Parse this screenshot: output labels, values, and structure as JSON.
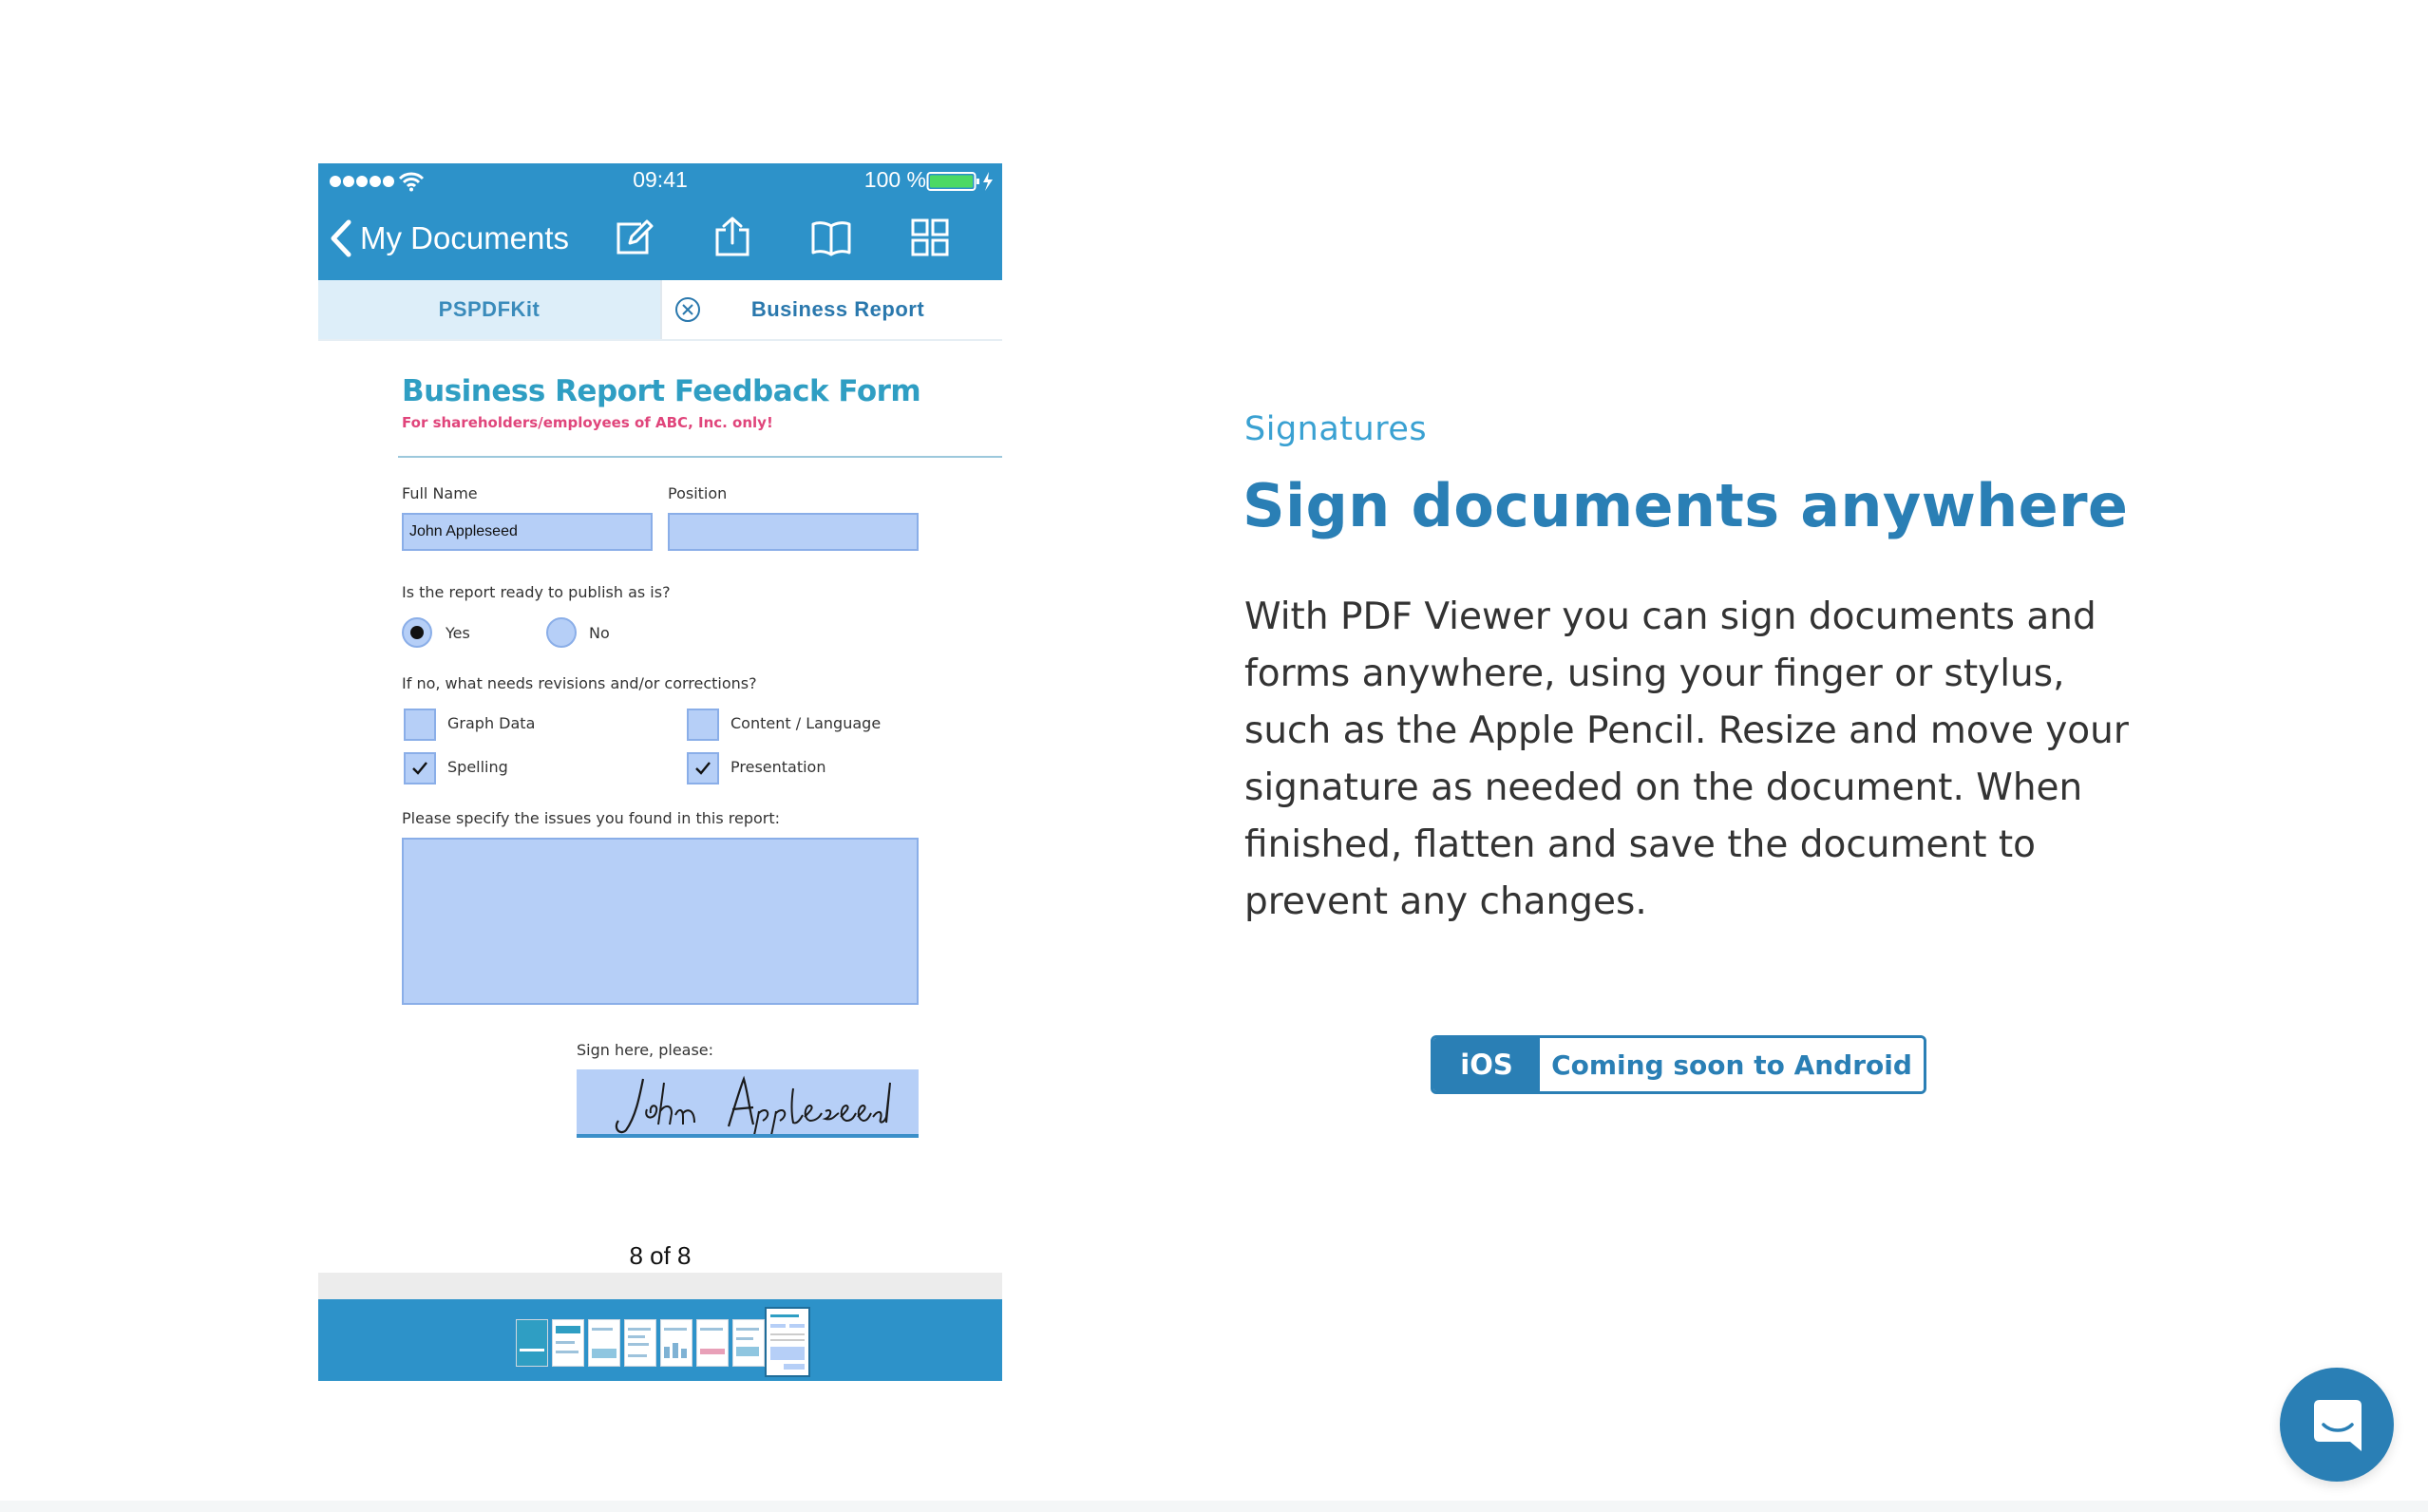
{
  "phone": {
    "status_bar": {
      "time": "09:41",
      "battery_percent": "100 %"
    },
    "nav": {
      "back_label": "My Documents"
    },
    "tabs": {
      "left": "PSPDFKit",
      "right": "Business Report"
    },
    "form": {
      "title": "Business Report Feedback Form",
      "subtitle": "For shareholders/employees of ABC, Inc. only!",
      "full_name_label": "Full Name",
      "full_name_value": "John Appleseed",
      "position_label": "Position",
      "position_value": "",
      "publish_question": "Is the report ready to publish as is?",
      "radio_yes": "Yes",
      "radio_no": "No",
      "revisions_question": "If no, what needs revisions and/or corrections?",
      "checkboxes": [
        {
          "label": "Graph Data",
          "checked": false
        },
        {
          "label": "Content / Language",
          "checked": false
        },
        {
          "label": "Spelling",
          "checked": true
        },
        {
          "label": "Presentation",
          "checked": true
        }
      ],
      "issues_question": "Please specify the issues you found in this report:",
      "sign_label": "Sign here, please:",
      "signature": "John Appleseed"
    },
    "page_indicator": "8 of 8",
    "thumbnails": {
      "count": 8,
      "active_index": 7
    }
  },
  "feature": {
    "eyebrow": "Signatures",
    "headline": "Sign documents anywhere",
    "description": "With PDF Viewer you can sign documents and forms anywhere, using your finger or stylus, such as the Apple Pencil. Resize and move your signature as needed on the document. When finished, flatten and save the document to prevent any changes.",
    "platform_ios": "iOS",
    "platform_android": "Coming soon to Android"
  },
  "colors": {
    "brand_blue": "#2d92c9",
    "headline_blue": "#2a7fb5",
    "eyebrow_blue": "#3aa1d2",
    "form_field": "#b6cff7",
    "subtitle_pink": "#e0457b",
    "battery_green": "#4cd964"
  },
  "icons": {
    "nav": [
      "chevron-left-icon",
      "edit-icon",
      "share-icon",
      "book-icon",
      "grid-icon"
    ],
    "tab_close": "close-circle-icon",
    "chat": "chat-bubble-icon"
  }
}
